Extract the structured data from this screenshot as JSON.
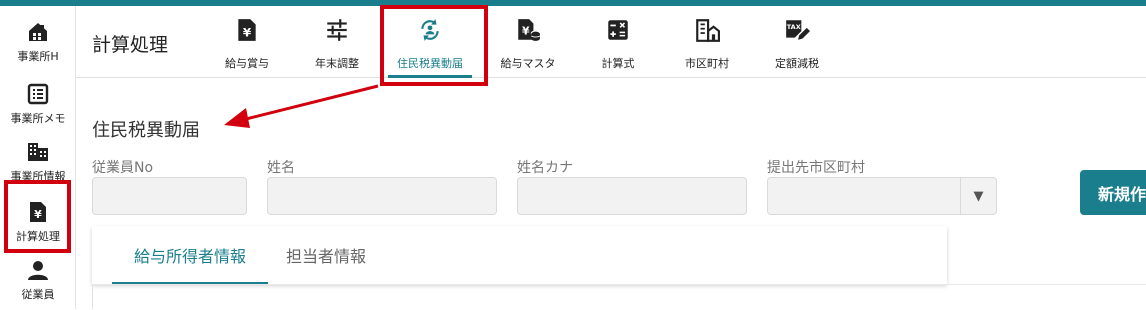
{
  "sidebar": {
    "items": [
      {
        "label": "事業所H",
        "icon": "building-home-icon"
      },
      {
        "label": "事業所メモ",
        "icon": "memo-list-icon"
      },
      {
        "label": "事業所情報",
        "icon": "office-building-icon"
      },
      {
        "label": "計算処理",
        "icon": "yen-document-icon"
      },
      {
        "label": "従業員",
        "icon": "person-icon"
      }
    ]
  },
  "header": {
    "title": "計算処理",
    "tabs": [
      {
        "label": "給与賞与",
        "icon": "yen-document-icon"
      },
      {
        "label": "年末調整",
        "icon": "sliders-icon"
      },
      {
        "label": "住民税異動届",
        "icon": "person-sync-icon"
      },
      {
        "label": "給与マスタ",
        "icon": "yen-database-icon"
      },
      {
        "label": "計算式",
        "icon": "calculator-icon"
      },
      {
        "label": "市区町村",
        "icon": "city-building-icon"
      },
      {
        "label": "定額減税",
        "icon": "tax-edit-icon"
      }
    ],
    "tax_icon_text": "TAX"
  },
  "page": {
    "heading": "住民税異動届",
    "fields": {
      "employee_no": {
        "label": "従業員No",
        "value": ""
      },
      "name": {
        "label": "姓名",
        "value": ""
      },
      "name_kana": {
        "label": "姓名カナ",
        "value": ""
      },
      "municipality": {
        "label": "提出先市区町村",
        "value": "",
        "arrow": "▼"
      }
    },
    "new_button": "新規作",
    "subtabs": [
      {
        "label": "給与所得者情報"
      },
      {
        "label": "担当者情報"
      }
    ]
  },
  "colors": {
    "accent": "#1a7e8c",
    "highlight": "#d2000f"
  }
}
